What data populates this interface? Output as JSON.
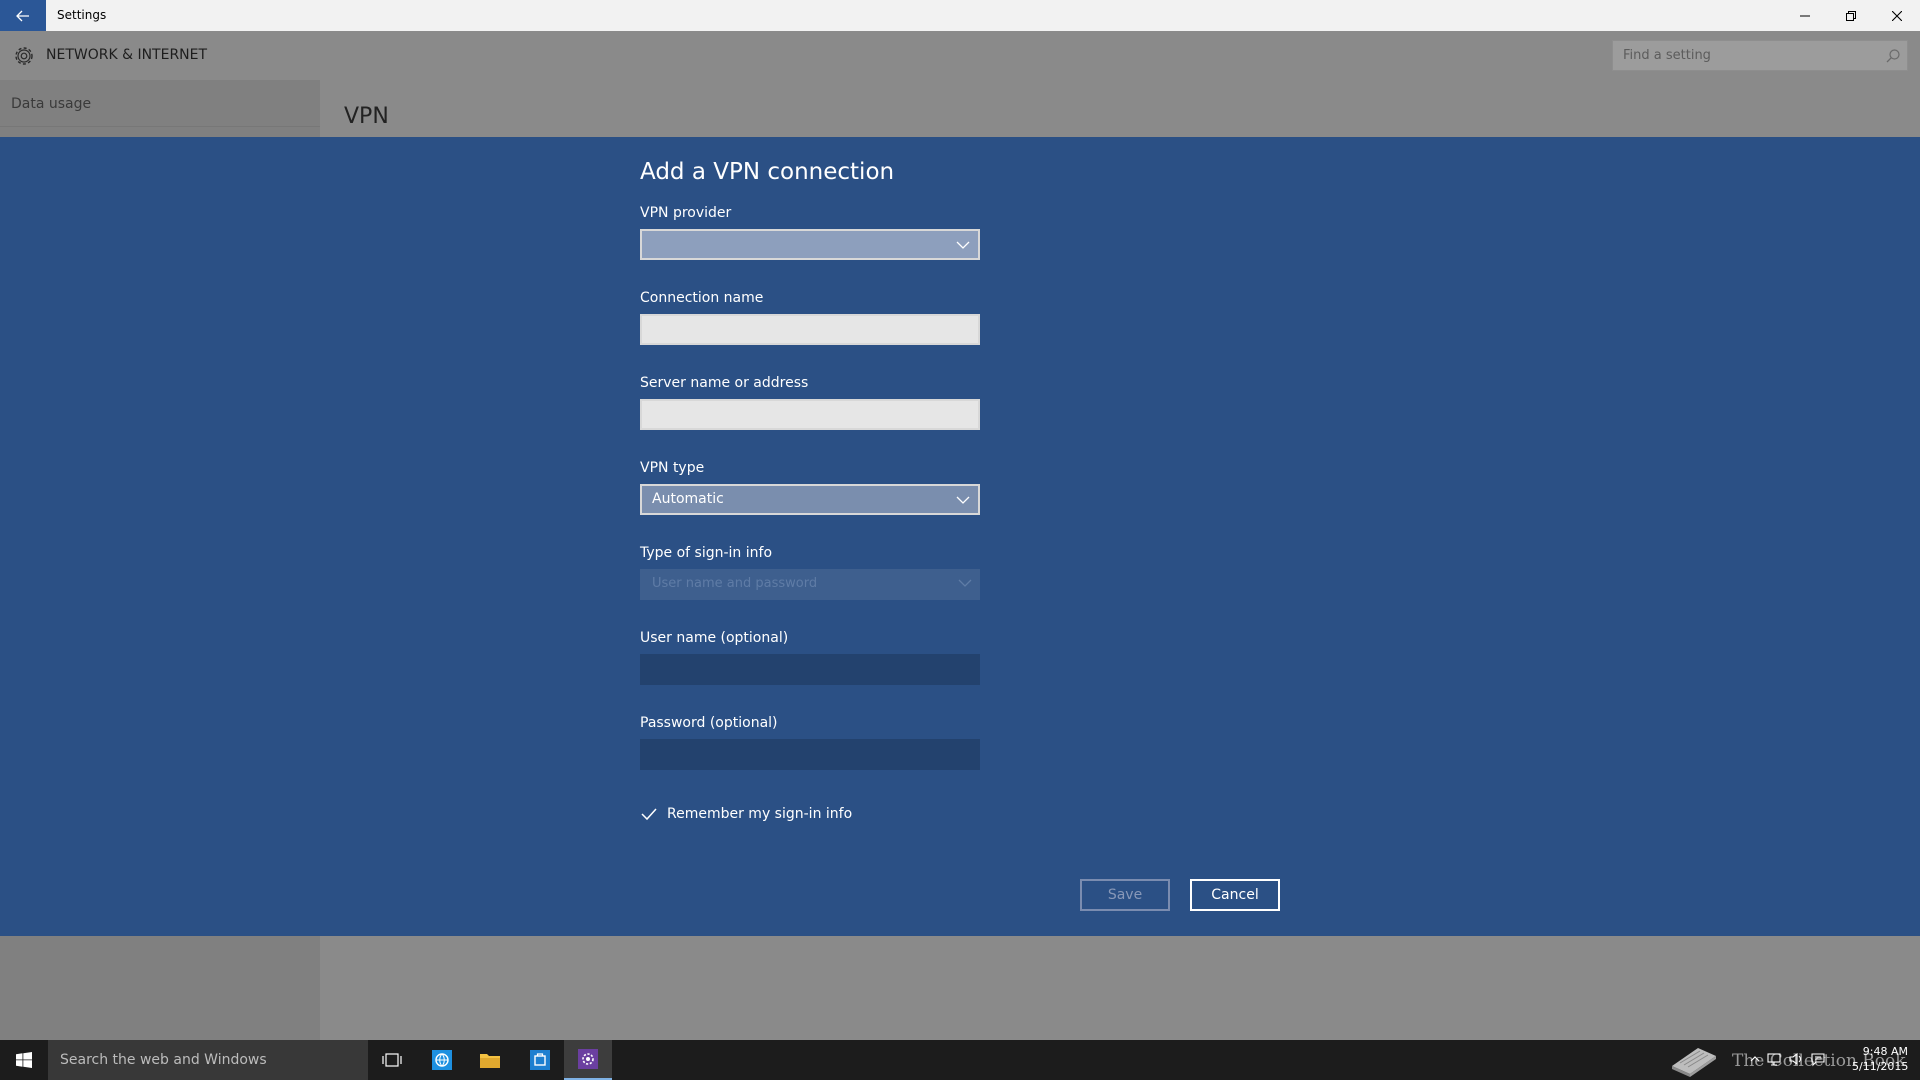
{
  "window": {
    "title": "Settings"
  },
  "header": {
    "title": "NETWORK & INTERNET",
    "search_placeholder": "Find a setting"
  },
  "sidebar": {
    "items": [
      {
        "label": "Data usage"
      }
    ]
  },
  "page": {
    "heading": "VPN"
  },
  "dialog": {
    "title": "Add a VPN connection",
    "fields": {
      "vpn_provider": {
        "label": "VPN provider",
        "value": ""
      },
      "connection_name": {
        "label": "Connection name",
        "value": ""
      },
      "server": {
        "label": "Server name or address",
        "value": ""
      },
      "vpn_type": {
        "label": "VPN type",
        "value": "Automatic"
      },
      "signin_type": {
        "label": "Type of sign-in info",
        "value": "User name and password"
      },
      "username": {
        "label": "User name (optional)",
        "value": ""
      },
      "password": {
        "label": "Password (optional)",
        "value": ""
      }
    },
    "remember": {
      "label": "Remember my sign-in info",
      "checked": true
    },
    "save_label": "Save",
    "cancel_label": "Cancel"
  },
  "taskbar": {
    "search_text": "Search the web and Windows",
    "watermark": "The Collection Book",
    "time": "9:48 AM",
    "date": "5/11/2015"
  },
  "colors": {
    "accent": "#2b5797",
    "dialog_bg": "#2b5085",
    "dimmed_bg": "#8a8a8a"
  },
  "icons": [
    "back-arrow-icon",
    "minimize-icon",
    "maximize-icon",
    "close-icon",
    "gear-icon",
    "search-icon",
    "chevron-down-icon",
    "checkmark-icon",
    "windows-logo-icon",
    "task-view-icon",
    "edge-icon",
    "file-explorer-icon",
    "store-icon",
    "settings-icon",
    "book-icon",
    "chevron-up-icon",
    "network-icon",
    "volume-icon",
    "action-center-icon"
  ]
}
